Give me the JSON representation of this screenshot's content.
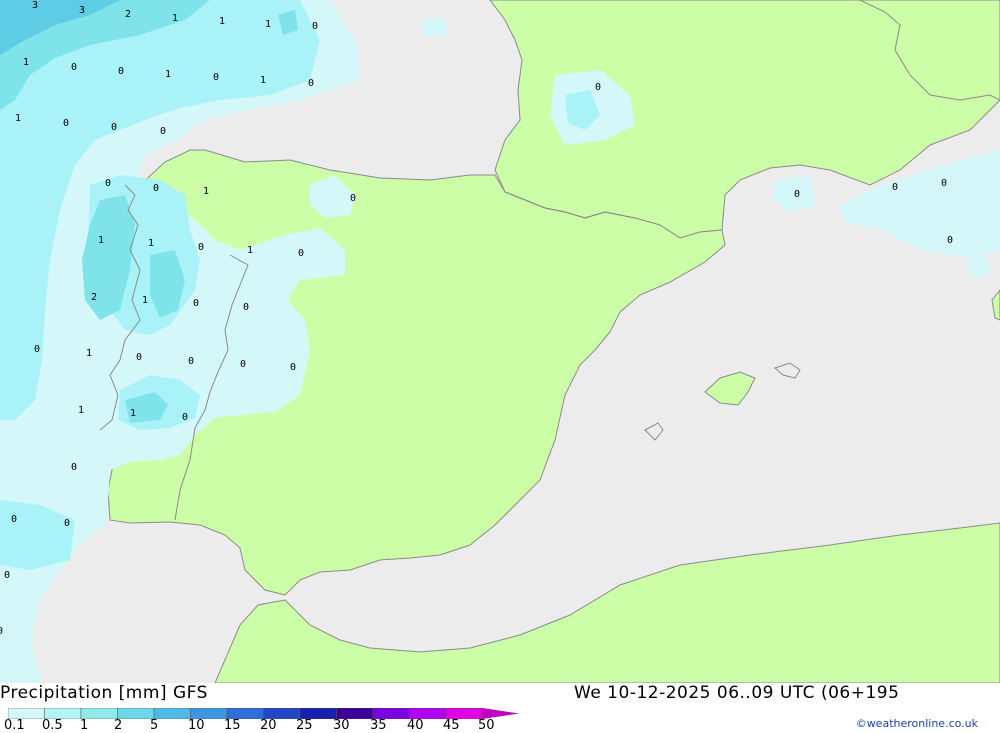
{
  "header": {
    "title": "Precipitation [mm] GFS",
    "timestamp": "We 10-12-2025 06..09 UTC (06+195"
  },
  "legend": {
    "labels": [
      "0.1",
      "0.5",
      "1",
      "2",
      "5",
      "10",
      "15",
      "20",
      "25",
      "30",
      "35",
      "40",
      "45",
      "50"
    ],
    "colors": [
      "#d4f7f9",
      "#b3f2f5",
      "#8feaea",
      "#6dd7e9",
      "#4fb9e6",
      "#3e96e1",
      "#2f6fd8",
      "#2446c4",
      "#1a1fae",
      "#3a0099",
      "#7a00e0",
      "#b000f0",
      "#e000e8",
      "#c000c0"
    ]
  },
  "credit": "©weatheronline.co.uk",
  "colors": {
    "land": "#ccfea8",
    "sea": "#ececec",
    "precip_light": "#d4f7f9",
    "precip_mid": "#a9f3f8",
    "precip_heavy": "#7fe3ea",
    "precip_max": "#5fcce6",
    "border": "#8a8a8a"
  },
  "map_values": [
    "3",
    "3",
    "2",
    "1",
    "1",
    "1",
    "0",
    "1",
    "0",
    "0",
    "1",
    "0",
    "1",
    "0",
    "1",
    "0",
    "0",
    "0",
    "0",
    "0",
    "1",
    "0",
    "0",
    "1",
    "1",
    "0",
    "1",
    "0",
    "2",
    "1",
    "0",
    "0",
    "0",
    "1",
    "0",
    "0",
    "0",
    "0",
    "1",
    "1",
    "0",
    "0",
    "0",
    "0",
    "0",
    "0",
    "0",
    "0",
    "0",
    "0"
  ]
}
